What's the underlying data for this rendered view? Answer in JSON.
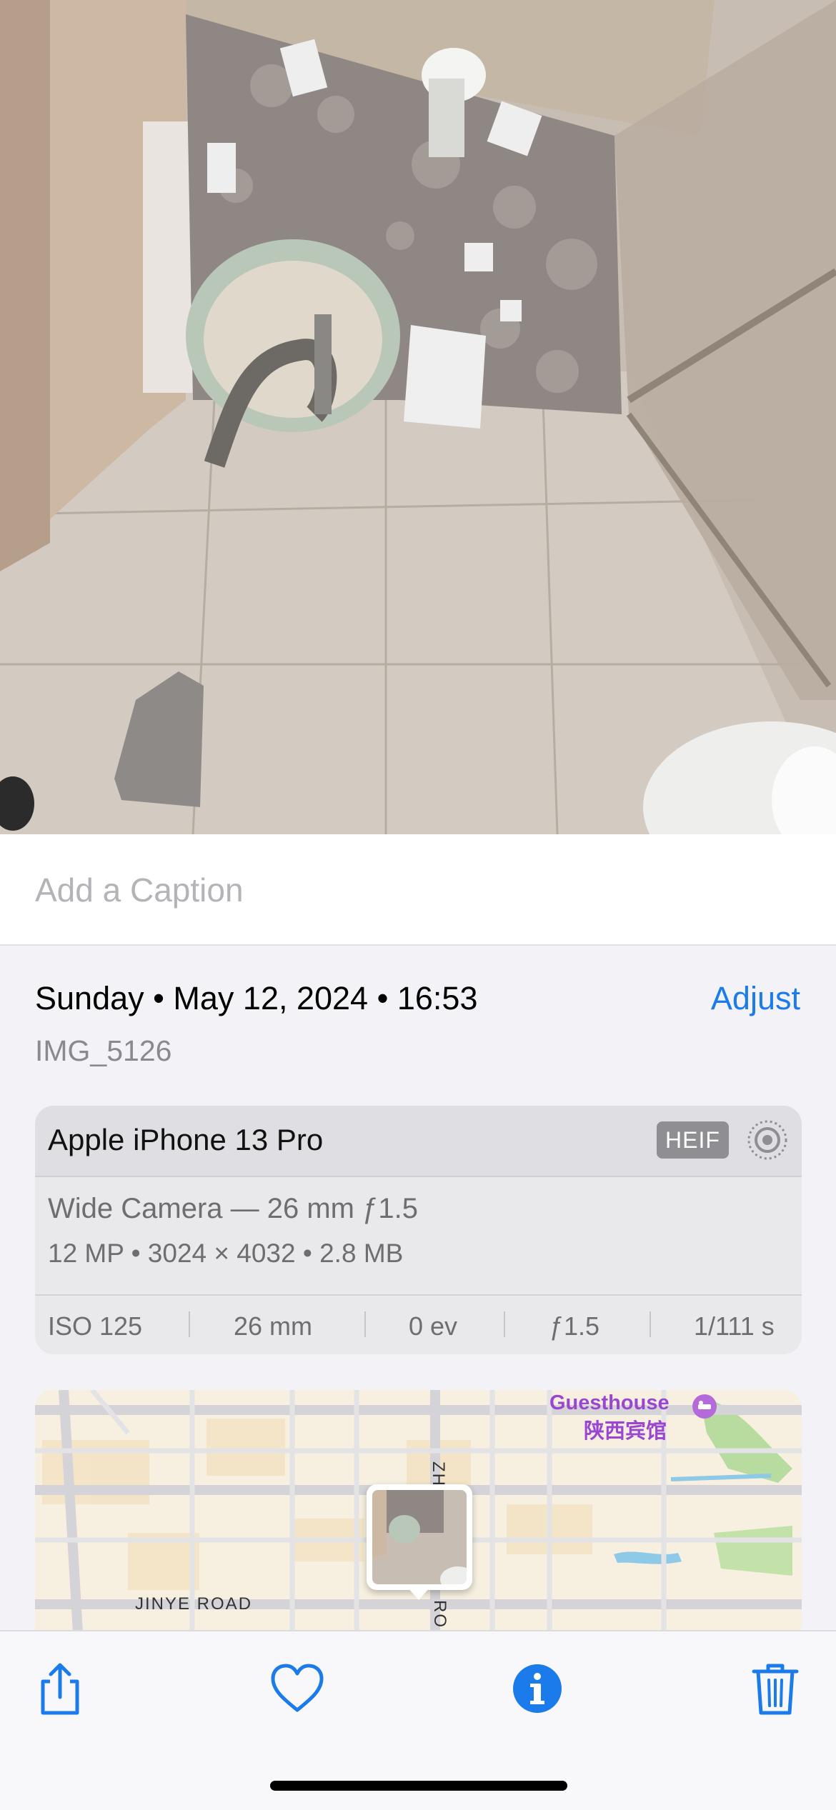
{
  "caption": {
    "placeholder": "Add a Caption"
  },
  "info": {
    "day": "Sunday",
    "date": "May 12, 2024",
    "time": "16:53",
    "adjust_label": "Adjust",
    "filename": "IMG_5126"
  },
  "camera": {
    "device": "Apple iPhone 13 Pro",
    "format_badge": "HEIF",
    "lens": "Wide Camera — 26 mm ƒ1.5",
    "megapixels": "12 MP",
    "resolution": "3024 × 4032",
    "file_size": "2.8 MB",
    "exif": {
      "iso": "ISO 125",
      "focal_length": "26 mm",
      "exposure_value": "0 ev",
      "aperture": "ƒ1.5",
      "shutter": "1/111 s"
    }
  },
  "map": {
    "road_label": "JINYE ROAD",
    "vertical_road_top": "ZH",
    "vertical_road_bottom": "RO",
    "poi_name_en": "Guesthouse",
    "poi_name_zh": "陕西宾馆"
  },
  "toolbar": {
    "share_icon": "share-icon",
    "favorite_icon": "heart-icon",
    "info_icon": "info-icon",
    "delete_icon": "trash-icon"
  },
  "colors": {
    "accent": "#1c7bea",
    "poi": "#9a46d0"
  }
}
